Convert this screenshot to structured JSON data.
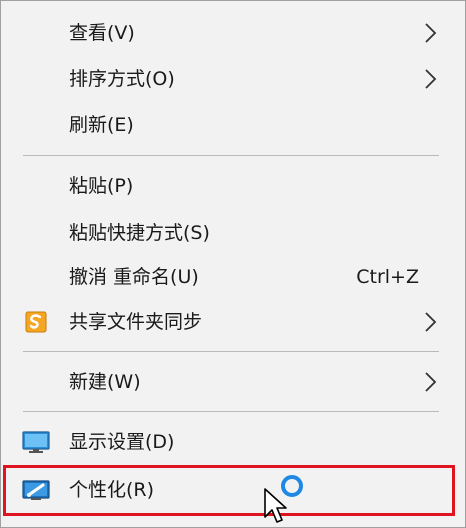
{
  "context_menu": {
    "items": [
      {
        "label": "查看(V)",
        "has_submenu": true
      },
      {
        "label": "排序方式(O)",
        "has_submenu": true
      },
      {
        "label": "刷新(E)"
      },
      {
        "label": "粘贴(P)"
      },
      {
        "label": "粘贴快捷方式(S)"
      },
      {
        "label": "撤消 重命名(U)",
        "shortcut": "Ctrl+Z"
      },
      {
        "label": "共享文件夹同步",
        "has_submenu": true,
        "icon": "shared-folder-sync-icon"
      },
      {
        "label": "新建(W)",
        "has_submenu": true
      },
      {
        "label": "显示设置(D)",
        "icon": "display-settings-icon"
      },
      {
        "label": "个性化(R)",
        "icon": "personalize-icon",
        "highlighted": true
      }
    ]
  },
  "colors": {
    "menu_background": "#f2f2f2",
    "separator": "#b9b9b9",
    "highlight_border": "#e0141e",
    "busy_ring": "#1e88e5",
    "sync_icon": "#f5a623",
    "display_icon": "#2a8fd6"
  },
  "cursor": "busy-pointer"
}
